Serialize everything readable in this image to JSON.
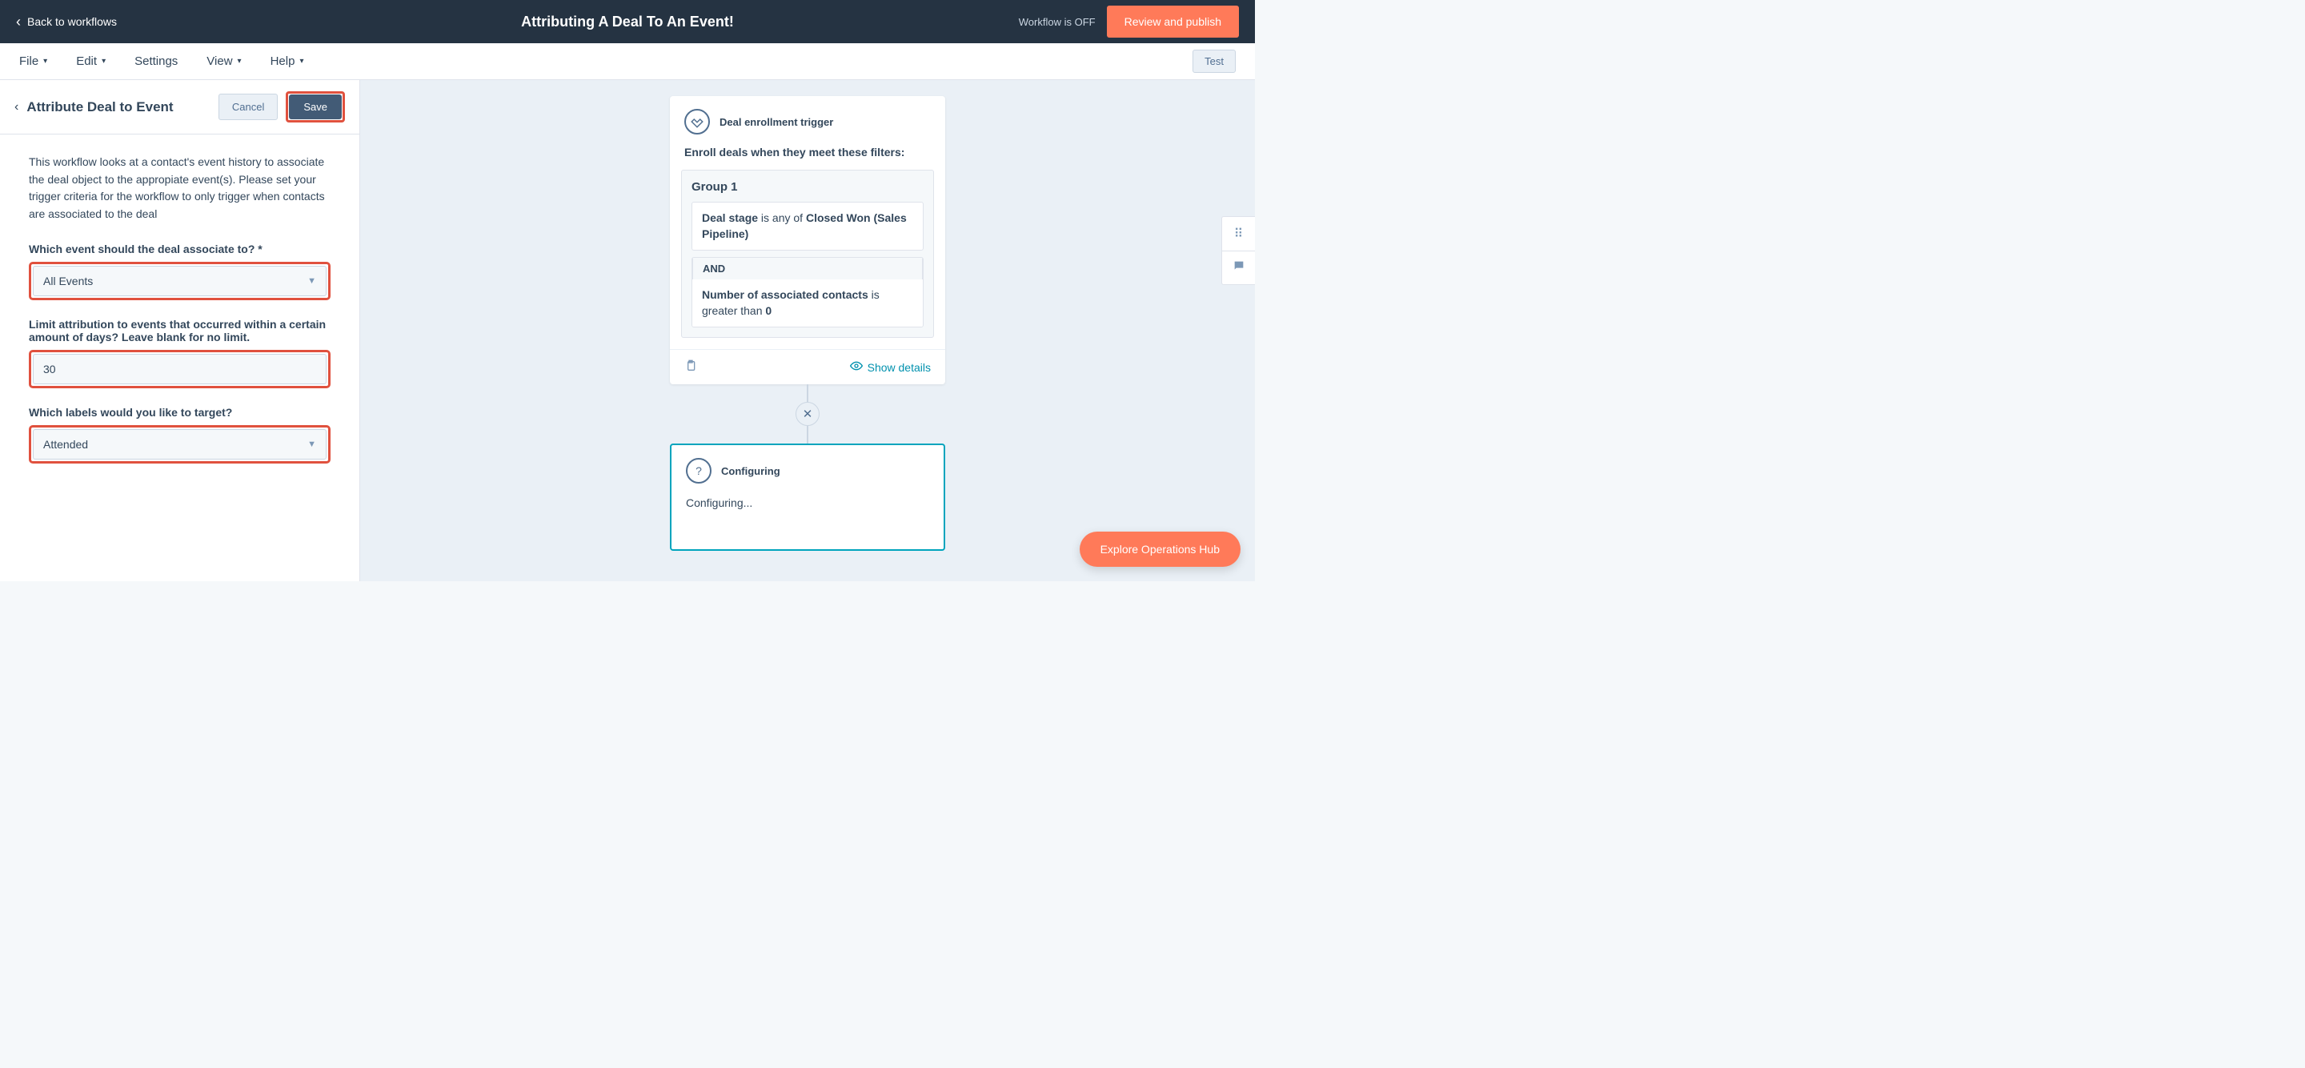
{
  "topbar": {
    "back_label": "Back to workflows",
    "title": "Attributing A Deal To An Event!",
    "status": "Workflow is OFF",
    "review_label": "Review and publish"
  },
  "menubar": {
    "file": "File",
    "edit": "Edit",
    "settings": "Settings",
    "view": "View",
    "help": "Help",
    "test": "Test"
  },
  "sidepanel": {
    "title": "Attribute Deal to Event",
    "cancel": "Cancel",
    "save": "Save",
    "description": "This workflow looks at a contact's event history to associate the deal object to the appropiate event(s). Please set your trigger criteria for the workflow to only trigger when contacts are associated to the deal",
    "field1_label": "Which event should the deal associate to? *",
    "field1_value": "All Events",
    "field2_label": "Limit attribution to events that occurred within a certain amount of days? Leave blank for no limit.",
    "field2_value": "30",
    "field3_label": "Which labels would you like to target?",
    "field3_value": "Attended"
  },
  "canvas": {
    "trigger_title": "Deal enrollment trigger",
    "enroll_text": "Enroll deals when they meet these filters:",
    "group_title": "Group 1",
    "filter1_strong1": "Deal stage",
    "filter1_mid": " is any of ",
    "filter1_strong2": "Closed Won (Sales Pipeline)",
    "and_label": "AND",
    "filter2_strong": "Number of associated contacts",
    "filter2_mid": " is greater than ",
    "filter2_val": "0",
    "show_details": "Show details",
    "config_title": "Configuring",
    "config_body": "Configuring..."
  },
  "explore_label": "Explore Operations Hub"
}
